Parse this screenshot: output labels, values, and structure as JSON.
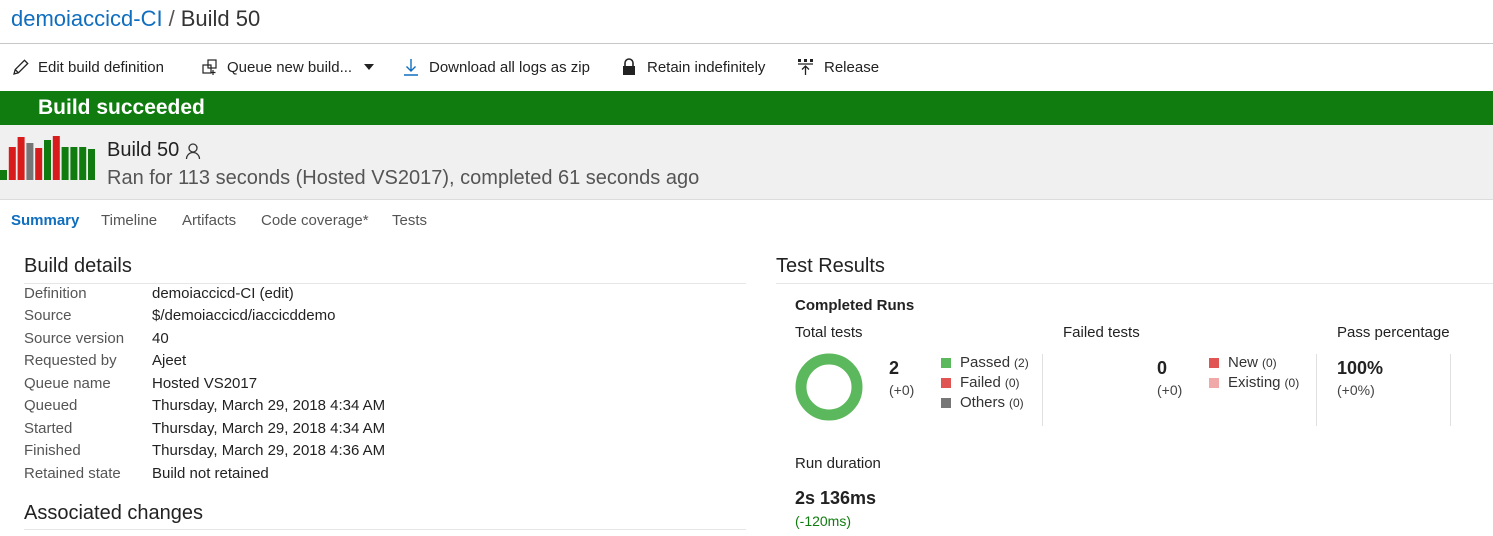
{
  "header": {
    "definition_link": "demoiaccicd-CI",
    "separator": "/",
    "current": "Build 50"
  },
  "toolbar": {
    "edit": "Edit build definition",
    "queue": "Queue new build...",
    "download": "Download all logs as zip",
    "retain": "Retain indefinitely",
    "release": "Release"
  },
  "banner": {
    "text": "Build succeeded",
    "color": "#107c10"
  },
  "build": {
    "name": "Build 50",
    "description": "Ran for 113 seconds (Hosted VS2017), completed 61 seconds ago",
    "history_bars": [
      {
        "status": "succeeded",
        "level": 0.22
      },
      {
        "status": "failed",
        "level": 0.74
      },
      {
        "status": "failed",
        "level": 0.98
      },
      {
        "status": "other",
        "level": 0.85
      },
      {
        "status": "failed",
        "level": 0.72
      },
      {
        "status": "succeeded",
        "level": 0.92
      },
      {
        "status": "failed",
        "level": 1.0
      },
      {
        "status": "succeeded",
        "level": 0.74
      },
      {
        "status": "succeeded",
        "level": 0.76
      },
      {
        "status": "succeeded",
        "level": 0.74
      },
      {
        "status": "succeeded",
        "level": 0.71
      }
    ],
    "colors": {
      "succeeded": "#107c10",
      "failed": "#d81c1c",
      "other": "#767676"
    }
  },
  "tabs": [
    {
      "label": "Summary",
      "active": true
    },
    {
      "label": "Timeline",
      "active": false
    },
    {
      "label": "Artifacts",
      "active": false
    },
    {
      "label": "Code coverage*",
      "active": false
    },
    {
      "label": "Tests",
      "active": false
    }
  ],
  "build_details": {
    "heading": "Build details",
    "rows": [
      {
        "label": "Definition",
        "value": "demoiaccicd-CI (edit)",
        "link": true
      },
      {
        "label": "Source",
        "value": "$/demoiaccicd/iaccicddemo",
        "link": true
      },
      {
        "label": "Source version",
        "value": "40",
        "link": true
      },
      {
        "label": "Requested by",
        "value": "Ajeet",
        "link": false
      },
      {
        "label": "Queue name",
        "value": "Hosted VS2017",
        "link": true
      },
      {
        "label": "Queued",
        "value": "Thursday, March 29, 2018 4:34 AM",
        "link": false
      },
      {
        "label": "Started",
        "value": "Thursday, March 29, 2018 4:34 AM",
        "link": false
      },
      {
        "label": "Finished",
        "value": "Thursday, March 29, 2018 4:36 AM",
        "link": false
      },
      {
        "label": "Retained state",
        "value": "Build not retained",
        "link": false
      }
    ]
  },
  "associated_changes": {
    "heading": "Associated changes"
  },
  "test_results": {
    "heading": "Test Results",
    "completed_runs": "Completed Runs",
    "total_tests": {
      "label": "Total tests",
      "value": "2",
      "delta": "(+0)",
      "pass_fraction": 1.0,
      "legend": [
        {
          "label": "Passed",
          "count": "(2)",
          "color": "#5cb85c"
        },
        {
          "label": "Failed",
          "count": "(0)",
          "color": "#e05454"
        },
        {
          "label": "Others",
          "count": "(0)",
          "color": "#767676"
        }
      ]
    },
    "failed_tests": {
      "label": "Failed tests",
      "value": "0",
      "delta": "(+0)",
      "legend": [
        {
          "label": "New",
          "count": "(0)",
          "color": "#e05454"
        },
        {
          "label": "Existing",
          "count": "(0)",
          "color": "#f0a8a8"
        }
      ]
    },
    "pass_percentage": {
      "label": "Pass percentage",
      "value": "100%",
      "delta": "(+0%)"
    },
    "run_duration": {
      "label": "Run duration",
      "value": "2s 136ms",
      "delta": "(-120ms)"
    }
  }
}
